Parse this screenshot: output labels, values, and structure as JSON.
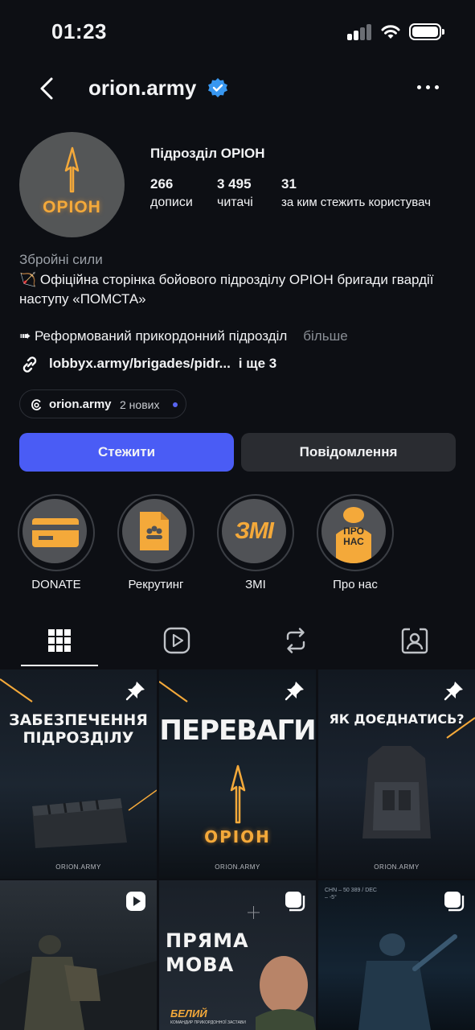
{
  "status_bar": {
    "time": "01:23"
  },
  "nav": {
    "username": "orion.army"
  },
  "profile": {
    "avatar_text": "ОРІОН",
    "name": "Підрозділ ОРІОН",
    "stats": [
      {
        "value": "266",
        "label": "дописи"
      },
      {
        "value": "3 495",
        "label": "читачі"
      },
      {
        "value": "31",
        "label": "за ким стежить користувач"
      }
    ],
    "category": "Збройні сили",
    "bio_line1": "🏹 Офіційна сторінка бойового підрозділу ОРІОН бригади гвардії наступу «ПОМСТА»",
    "bio_line2": "➠ Реформований прикордонний підрозділ",
    "more": "більше",
    "link": "lobbyx.army/brigades/pidr...",
    "link_extra": "і ще 3",
    "threads_name": "orion.army",
    "threads_count": "2 нових"
  },
  "actions": {
    "follow": "Стежити",
    "message": "Повідомлення"
  },
  "highlights": [
    {
      "label": "DONATE",
      "badge": ""
    },
    {
      "label": "Рекрутинг",
      "badge": ""
    },
    {
      "label": "ЗМІ",
      "badge": "ЗМІ"
    },
    {
      "label": "Про нас",
      "badge": "ПРО НАС"
    }
  ],
  "posts": [
    {
      "title": "ЗАБЕЗПЕЧЕННЯ ПІДРОЗДІЛУ",
      "footer": "ORION.ARMY",
      "icon": "pin-icon"
    },
    {
      "title": "ПЕРЕВАГИ",
      "subtitle": "ОРІОН",
      "footer": "ORION.ARMY",
      "icon": "pin-icon"
    },
    {
      "title": "ЯК ДОЄДНАТИСЬ?",
      "footer": "ORION.ARMY",
      "icon": "pin-icon"
    },
    {
      "title": "",
      "footer": "",
      "icon": "reel-icon"
    },
    {
      "title": "ПРЯМА МОВА",
      "caption": "БЕЛИЙ",
      "subcaption": "КОМАНДИР ПРИКОРДОННОЇ ЗАСТАВИ",
      "icon": "carousel-icon"
    },
    {
      "title": "",
      "hud": "CHN – 50 389 / DEC – -5°",
      "icon": "carousel-icon"
    }
  ],
  "colors": {
    "accent": "#4a5cf5",
    "orange": "#f4a93a",
    "background": "#0d0f14"
  }
}
